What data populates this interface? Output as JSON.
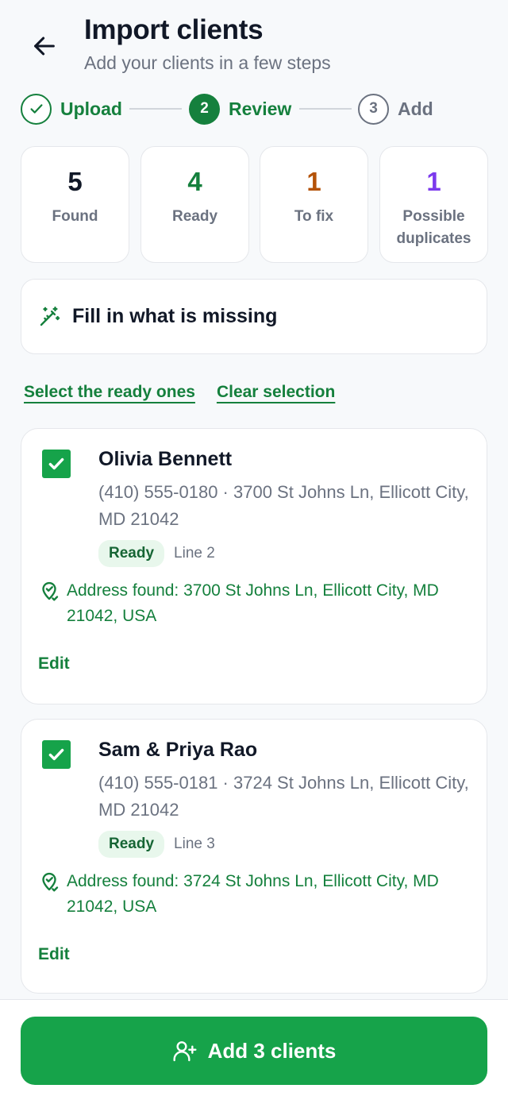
{
  "header": {
    "title": "Import clients",
    "subtitle": "Add your clients in a few steps",
    "back_icon": "arrow-left-icon"
  },
  "stepper": {
    "steps": [
      {
        "number": "✓",
        "label": "Upload",
        "state": "complete"
      },
      {
        "number": "2",
        "label": "Review",
        "state": "current"
      },
      {
        "number": "3",
        "label": "Add",
        "state": "upcoming"
      }
    ]
  },
  "stats": [
    {
      "value": "5",
      "label": "Found",
      "color": "#111827"
    },
    {
      "value": "4",
      "label": "Ready",
      "color": "#15803d"
    },
    {
      "value": "1",
      "label": "To fix",
      "color": "#b45309"
    },
    {
      "value": "1",
      "label": "Possible duplicates",
      "color": "#7c3aed"
    }
  ],
  "fill_missing": {
    "label": "Fill in what is missing",
    "icon": "magic-wand-icon"
  },
  "selection_links": {
    "select_ready": "Select the ready ones",
    "clear": "Clear selection"
  },
  "clients": [
    {
      "name": "Olivia Bennett",
      "info": "(410) 555-0180 · 3700 St Johns Ln, Ellicott City, MD 21042",
      "status": "Ready",
      "line": "Line 2",
      "address": "Address found: 3700 St Johns Ln, Ellicott City, MD 21042, USA",
      "edit": "Edit",
      "checked": true
    },
    {
      "name": "Sam & Priya Rao",
      "info": "(410) 555-0181 · 3724 St Johns Ln, Ellicott City, MD 21042",
      "status": "Ready",
      "line": "Line 3",
      "address": "Address found: 3724 St Johns Ln, Ellicott City, MD 21042, USA",
      "edit": "Edit",
      "checked": true
    }
  ],
  "primary_action": {
    "label": "Add 3 clients",
    "icon": "user-plus-icon"
  },
  "colors": {
    "accent": "#16a34a",
    "accent_text": "#15803d",
    "badge_bg": "#e8f7ec",
    "muted_text": "#6b7280",
    "border": "#e5e7eb"
  }
}
